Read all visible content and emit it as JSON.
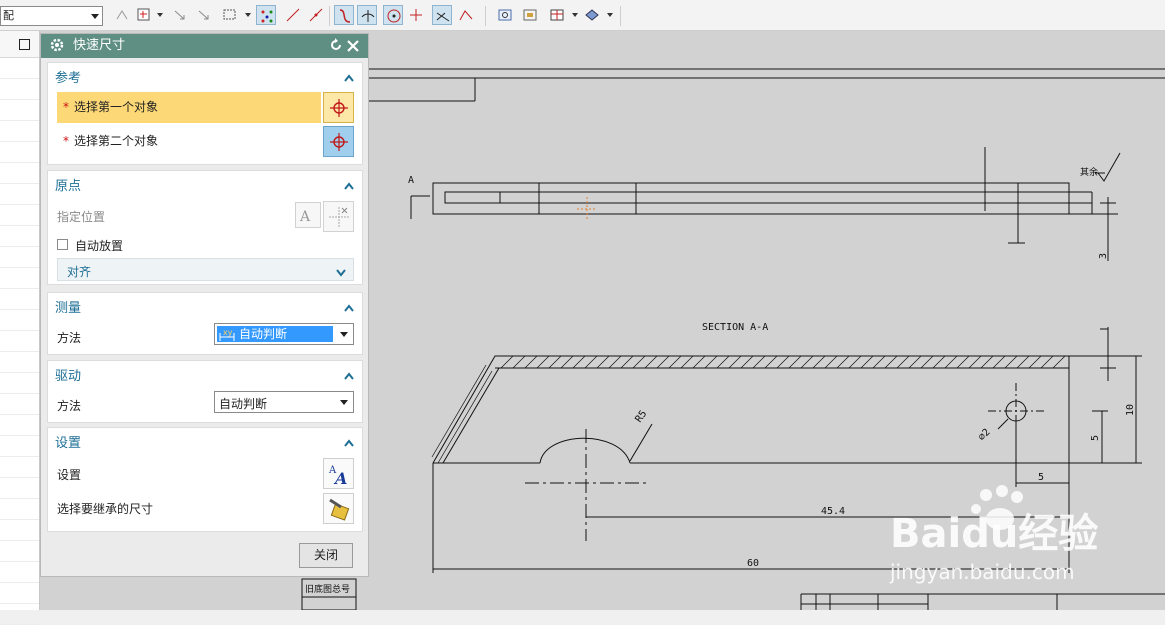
{
  "toolbar": {
    "assembly_select": "配"
  },
  "dialog": {
    "title": "快速尺寸",
    "reference": {
      "heading": "参考",
      "first_object": "选择第一个对象",
      "second_object": "选择第二个对象"
    },
    "origin": {
      "heading": "原点",
      "specify_location": "指定位置",
      "auto_place": "自动放置",
      "align": "对齐"
    },
    "measurement": {
      "heading": "测量",
      "method_label": "方法",
      "method_value": "自动判断"
    },
    "driving": {
      "heading": "驱动",
      "method_label": "方法",
      "method_value": "自动判断"
    },
    "settings": {
      "heading": "设置",
      "settings_label": "设置",
      "inherit_label": "选择要继承的尺寸"
    },
    "close_label": "关闭"
  },
  "drawing": {
    "section_label": "SECTION A-A",
    "view_marker": "A",
    "dims": {
      "d60": "60",
      "d45_4": "45.4",
      "d5_h": "5",
      "d5_v": "5",
      "d10": "10",
      "d3": "3",
      "radius": "R5",
      "diameter": "⌀2",
      "surface_note": "其余"
    },
    "title_cell": "旧底图总号"
  },
  "watermark": {
    "brand": "Baidu经验",
    "url": "jingyan.baidu.com"
  }
}
